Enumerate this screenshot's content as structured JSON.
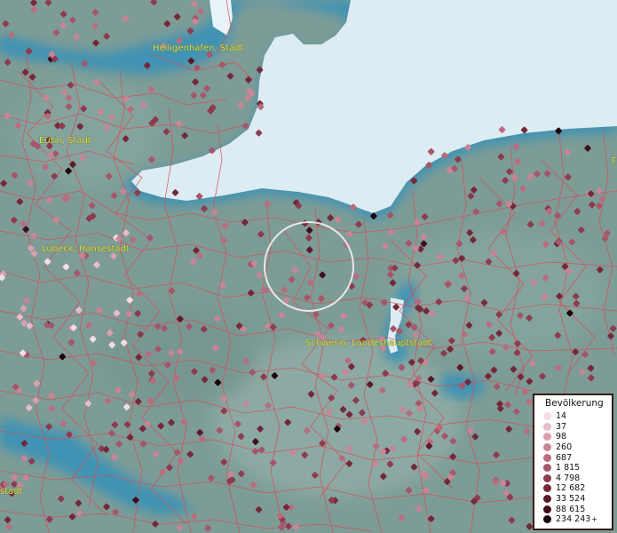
{
  "map": {
    "places": [
      {
        "name": "Heiligenhafen, Stadt"
      },
      {
        "name": "Eutin, Stadt"
      },
      {
        "name": "Lübeck, Hansestadt"
      },
      {
        "name": "Schwerin, Landeshauptstadt"
      },
      {
        "name": "stadt"
      },
      {
        "name": "F"
      }
    ],
    "colors": {
      "land": "#7d9c96",
      "sea": "#dcecf2",
      "water_edge": "#3f93b4",
      "boundary": "#d84a55",
      "selection_ring": "#f2f2f2"
    }
  },
  "legend": {
    "title": "Bevölkerung",
    "plus": "+",
    "classes": [
      {
        "label": "14",
        "color": "#f4dde6"
      },
      {
        "label": "37",
        "color": "#e8bcc9"
      },
      {
        "label": "98",
        "color": "#d9a0af"
      },
      {
        "label": "260",
        "color": "#c98596"
      },
      {
        "label": "687",
        "color": "#b86d7f"
      },
      {
        "label": "1 815",
        "color": "#a5566a"
      },
      {
        "label": "4 798",
        "color": "#8d3b4f"
      },
      {
        "label": "12 682",
        "color": "#74293a"
      },
      {
        "label": "33 524",
        "color": "#5b1a29"
      },
      {
        "label": "88 615",
        "color": "#3f0f1b"
      },
      {
        "label": "234 243",
        "color": "#1a0509"
      }
    ]
  }
}
